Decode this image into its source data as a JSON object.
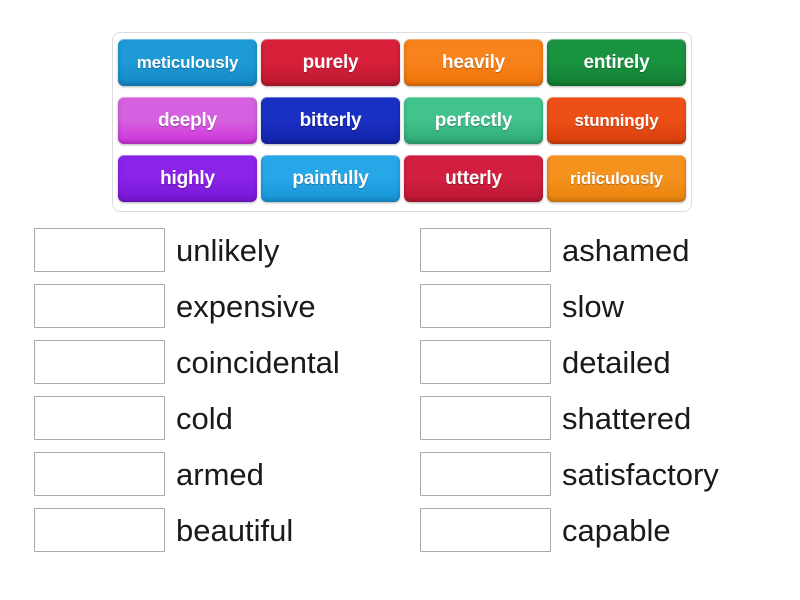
{
  "activity": {
    "type": "match-up-drag-drop",
    "background_color": "#ffffff"
  },
  "word_bank": {
    "border_color": "#dcdcdc",
    "rows": [
      [
        {
          "label": "meticulously",
          "color": "#1e9ad6",
          "color_dark": "#1487c4"
        },
        {
          "label": "purely",
          "color": "#d8203a",
          "color_dark": "#bb1730"
        },
        {
          "label": "heavily",
          "color": "#f8821b",
          "color_dark": "#ed7408"
        },
        {
          "label": "entirely",
          "color": "#19933f",
          "color_dark": "#137c33"
        }
      ],
      [
        {
          "label": "deeply",
          "color": "#d661e0",
          "color_dark": "#cc33d9"
        },
        {
          "label": "bitterly",
          "color": "#1a2fc4",
          "color_dark": "#1224a8"
        },
        {
          "label": "perfectly",
          "color": "#42c28c",
          "color_dark": "#2fab77"
        },
        {
          "label": "stunningly",
          "color": "#ed4f17",
          "color_dark": "#d83f0c"
        }
      ],
      [
        {
          "label": "highly",
          "color": "#8a24e8",
          "color_dark": "#7715d4"
        },
        {
          "label": "painfully",
          "color": "#27a6e8",
          "color_dark": "#1894d6"
        },
        {
          "label": "utterly",
          "color": "#d31f3f",
          "color_dark": "#bb1734"
        },
        {
          "label": "ridiculously",
          "color": "#f5921e",
          "color_dark": "#e8830c"
        }
      ]
    ]
  },
  "answers": {
    "left_column": [
      {
        "drop_value": "",
        "word": "unlikely"
      },
      {
        "drop_value": "",
        "word": "expensive"
      },
      {
        "drop_value": "",
        "word": "coincidental"
      },
      {
        "drop_value": "",
        "word": "cold"
      },
      {
        "drop_value": "",
        "word": "armed"
      },
      {
        "drop_value": "",
        "word": "beautiful"
      }
    ],
    "right_column": [
      {
        "drop_value": "",
        "word": "ashamed"
      },
      {
        "drop_value": "",
        "word": "slow"
      },
      {
        "drop_value": "",
        "word": "detailed"
      },
      {
        "drop_value": "",
        "word": "shattered"
      },
      {
        "drop_value": "",
        "word": "satisfactory"
      },
      {
        "drop_value": "",
        "word": "capable"
      }
    ]
  }
}
